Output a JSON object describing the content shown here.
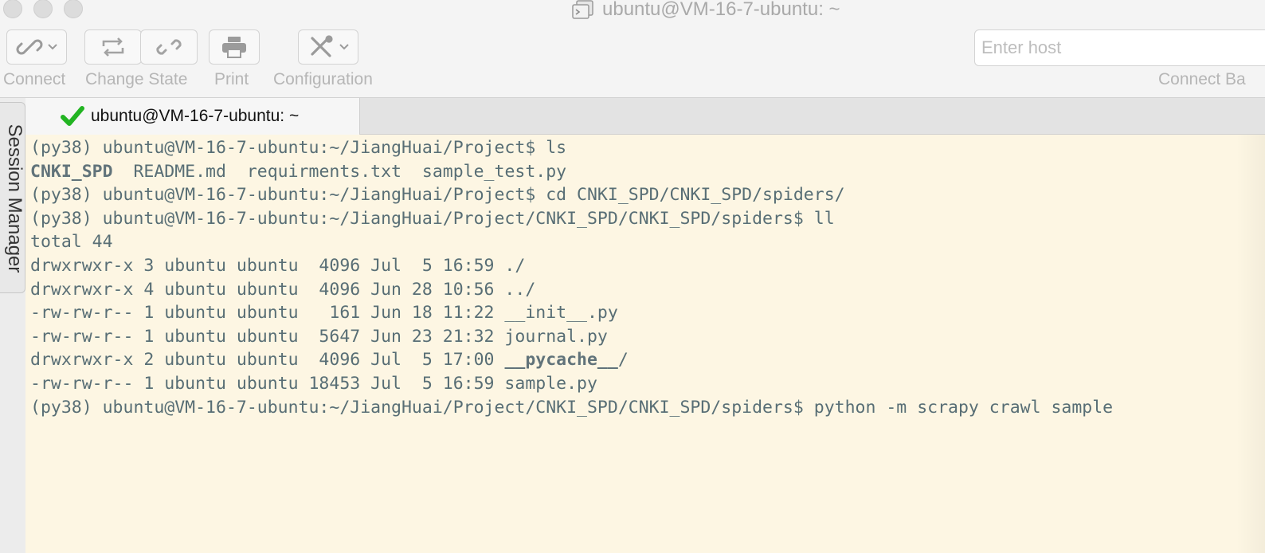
{
  "window": {
    "title": "ubuntu@VM-16-7-ubuntu: ~"
  },
  "toolbar": {
    "connect_label": "Connect",
    "change_state_label": "Change State",
    "print_label": "Print",
    "configuration_label": "Configuration",
    "host_placeholder": "Enter host",
    "connect_bar_label": "Connect Ba"
  },
  "icons": {
    "connect": "link-icon",
    "change_state": "refresh-icon",
    "disconnect": "broken-link-icon",
    "print": "printer-icon",
    "configuration": "tools-icon",
    "tab_status": "checkmark-icon",
    "title": "terminal-app-icon"
  },
  "sidebar": {
    "session_manager_label": "Session Manager"
  },
  "tabs": [
    {
      "label": "ubuntu@VM-16-7-ubuntu: ~",
      "status": "connected"
    }
  ],
  "colors": {
    "terminal_bg": "#fdf6e3",
    "terminal_fg": "#586e75",
    "connected_check": "#22b422"
  },
  "terminal": {
    "lines": [
      {
        "text": "(py38) ubuntu@VM-16-7-ubuntu:~/JiangHuai/Project$ ls"
      },
      {
        "parts": [
          {
            "text": "CNKI_SPD",
            "kind": "dir"
          },
          {
            "text": "  README.md  requirments.txt  sample_test.py",
            "kind": "plain"
          }
        ]
      },
      {
        "text": "(py38) ubuntu@VM-16-7-ubuntu:~/JiangHuai/Project$ cd CNKI_SPD/CNKI_SPD/spiders/"
      },
      {
        "text": "(py38) ubuntu@VM-16-7-ubuntu:~/JiangHuai/Project/CNKI_SPD/CNKI_SPD/spiders$ ll"
      },
      {
        "text": "total 44"
      },
      {
        "text": "drwxrwxr-x 3 ubuntu ubuntu  4096 Jul  5 16:59 ./"
      },
      {
        "text": "drwxrwxr-x 4 ubuntu ubuntu  4096 Jun 28 10:56 ../"
      },
      {
        "text": "-rw-rw-r-- 1 ubuntu ubuntu   161 Jun 18 11:22 __init__.py"
      },
      {
        "text": "-rw-rw-r-- 1 ubuntu ubuntu  5647 Jun 23 21:32 journal.py"
      },
      {
        "parts": [
          {
            "text": "drwxrwxr-x 2 ubuntu ubuntu  4096 Jul  5 17:00 ",
            "kind": "plain"
          },
          {
            "text": "__pycache__",
            "kind": "dir"
          },
          {
            "text": "/",
            "kind": "plain"
          }
        ]
      },
      {
        "text": "-rw-rw-r-- 1 ubuntu ubuntu 18453 Jul  5 16:59 sample.py"
      },
      {
        "text": "(py38) ubuntu@VM-16-7-ubuntu:~/JiangHuai/Project/CNKI_SPD/CNKI_SPD/spiders$ python -m scrapy crawl sample"
      }
    ]
  }
}
